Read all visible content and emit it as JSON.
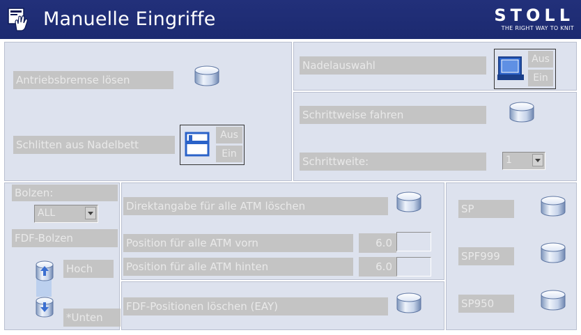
{
  "header": {
    "title": "Manuelle Eingriffe",
    "brand": "STOLL",
    "slogan": "THE RIGHT WAY TO KNIT"
  },
  "brake": {
    "label": "Antriebsbremse lösen"
  },
  "carriage": {
    "label": "Schlitten aus Nadelbett",
    "off": "Aus",
    "on": "Ein"
  },
  "needle": {
    "label": "Nadelauswahl",
    "off": "Aus",
    "on": "Ein"
  },
  "step": {
    "label": "Schrittweise fahren",
    "width_label": "Schrittweite:",
    "width_value": "1"
  },
  "bolts": {
    "label": "Bolzen:",
    "select_value": "ALL",
    "fdf_label": "FDF-Bolzen",
    "up_label": "Hoch",
    "down_label": "*Unten"
  },
  "atm": {
    "clear_label": "Direktangabe für alle ATM löschen",
    "front_label": "Position für alle ATM vorn",
    "front_value": "6.0",
    "rear_label": "Position für alle ATM hinten",
    "rear_value": "6.0",
    "fdf_clear_label": "FDF-Positionen löschen (EAY)"
  },
  "sp": {
    "sp_label": "SP",
    "spf999_label": "SPF999",
    "sp950_label": "SP950"
  },
  "colors": {
    "header": "#1f2d74",
    "panel": "#dde2ee",
    "label_bg": "#c4c4c4",
    "label_text": "#e9e9e9"
  }
}
